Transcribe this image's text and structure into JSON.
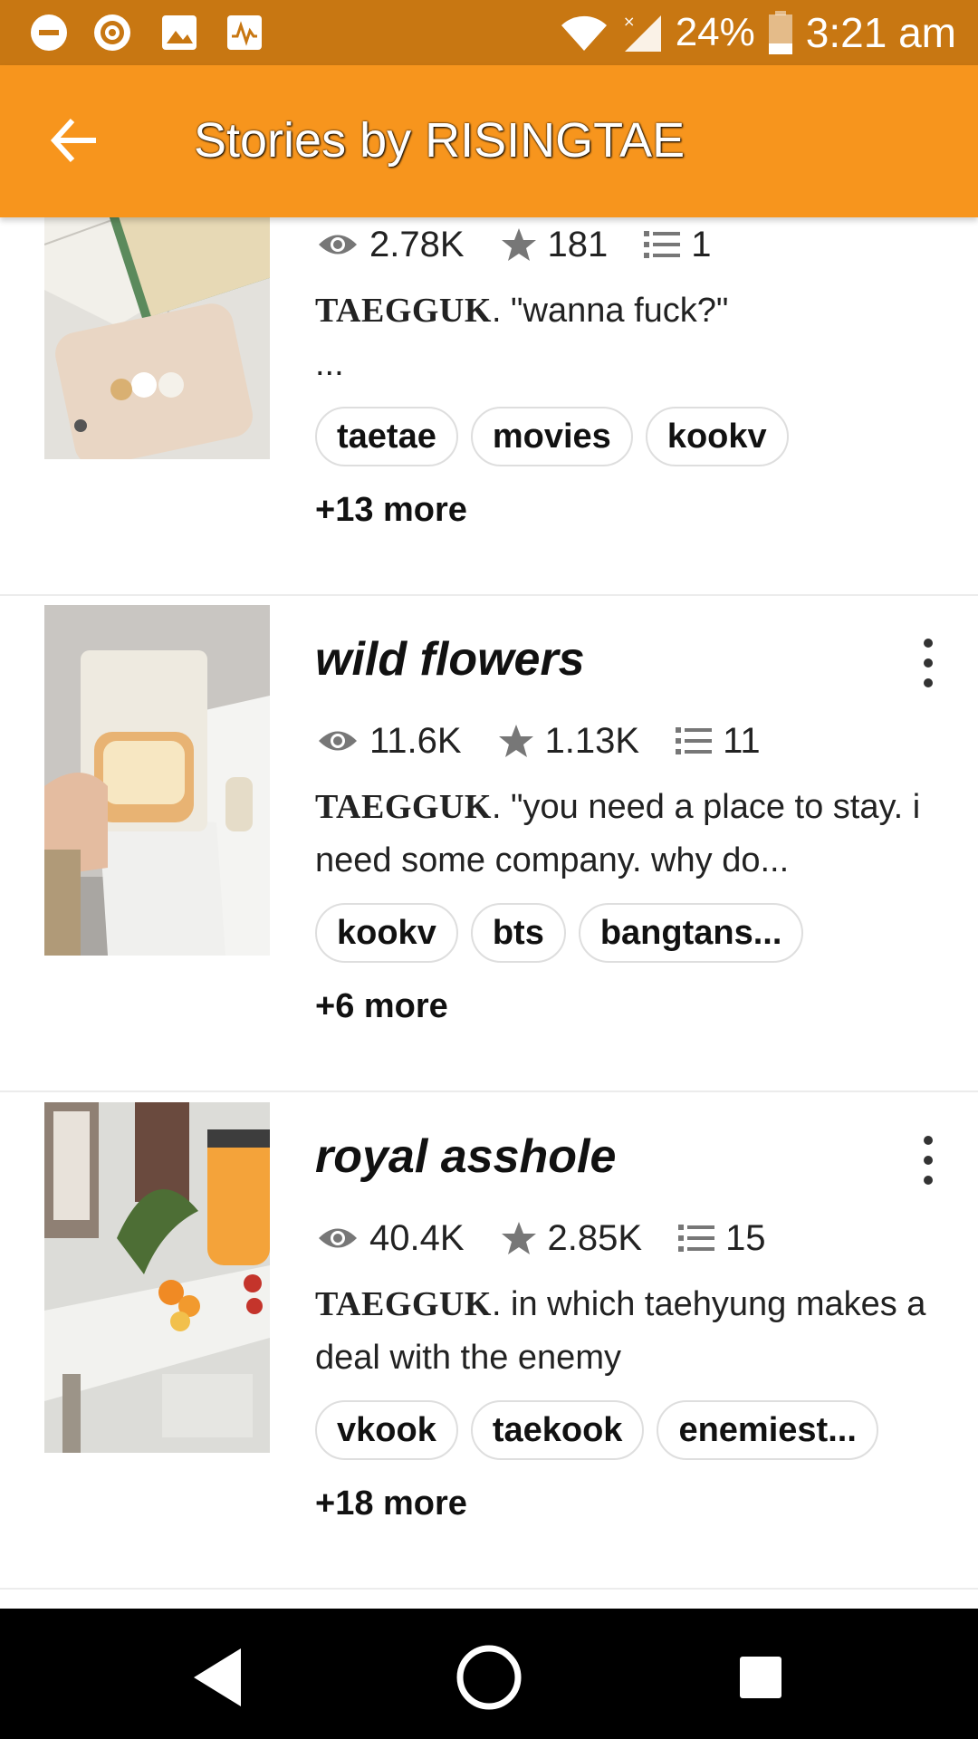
{
  "status_bar": {
    "battery": "24%",
    "time": "3:21 am",
    "icons": [
      "minus-circle-icon",
      "target-icon",
      "image-icon",
      "pulse-icon",
      "wifi-icon",
      "signal-icon",
      "battery-icon"
    ]
  },
  "app_bar": {
    "title": "Stories by RISINGTAE",
    "back_icon": "arrow-left-icon"
  },
  "stories": [
    {
      "title": "",
      "views": "2.78K",
      "votes": "181",
      "parts": "1",
      "desc_title": "TAEGGUK",
      "description": ". \"wanna fuck?\"\n...",
      "tags": [
        "taetae",
        "movies",
        "kookv"
      ],
      "more": "+13 more"
    },
    {
      "title": "wild flowers",
      "views": "11.6K",
      "votes": "1.13K",
      "parts": "11",
      "desc_title": "TAEGGUK",
      "description": ". \"you need a place to stay. i need some company. why do...",
      "tags": [
        "kookv",
        "bts",
        "bangtans..."
      ],
      "more": "+6 more"
    },
    {
      "title": "royal asshole",
      "views": "40.4K",
      "votes": "2.85K",
      "parts": "15",
      "desc_title": "TAEGGUK",
      "description": ". in which taehyung makes a deal with the enemy",
      "tags": [
        "vkook",
        "taekook",
        "enemiest..."
      ],
      "more": "+18 more"
    }
  ],
  "nav_bar": {
    "icons": [
      "back-triangle-icon",
      "home-circle-icon",
      "recents-square-icon"
    ]
  },
  "colors": {
    "status_bar": "#c87712",
    "app_bar": "#f7951d",
    "nav_bar": "#000000"
  }
}
